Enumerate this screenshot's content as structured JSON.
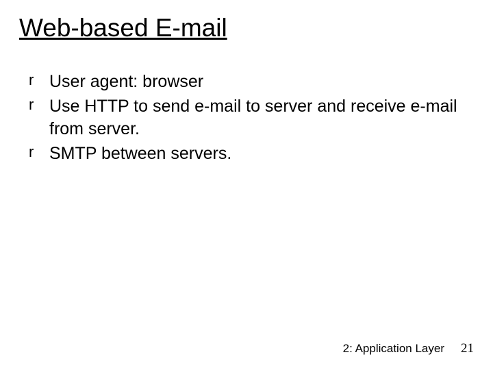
{
  "title": "Web-based E-mail",
  "bullet_marker": "r",
  "bullets": [
    "User agent: browser",
    "Use HTTP to send e-mail to server and receive e-mail from server.",
    "SMTP between servers."
  ],
  "footer": {
    "chapter_label": "2: Application Layer",
    "page_number": "21"
  }
}
